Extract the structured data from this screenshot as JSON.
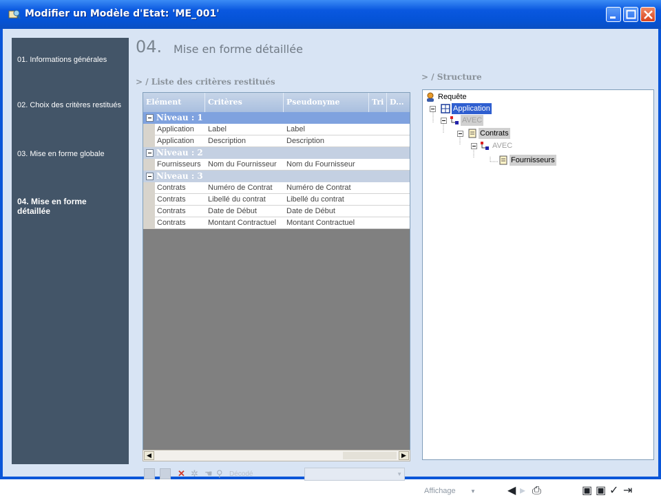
{
  "window": {
    "title": "Modifier un Modèle d'Etat: 'ME_001'"
  },
  "nav": {
    "items": [
      {
        "label": "01. Informations générales"
      },
      {
        "label": "02. Choix des critères restitués"
      },
      {
        "label": "03. Mise en forme globale"
      },
      {
        "label": "04. Mise en forme détaillée"
      }
    ]
  },
  "main": {
    "step_number": "04.",
    "step_title": "Mise en forme détaillée",
    "list_title": "> / Liste des critères restitués",
    "columns": [
      "Elément",
      "Critères",
      "Pseudonyme",
      "Tri",
      "D..."
    ],
    "groups": [
      {
        "label": "Niveau : 1",
        "rows": [
          [
            "Application",
            "Label",
            "Label"
          ],
          [
            "Application",
            "Description",
            "Description"
          ]
        ]
      },
      {
        "label": "Niveau : 2",
        "rows": [
          [
            "Fournisseurs",
            "Nom du Fournisseur",
            "Nom du Fournisseur"
          ]
        ]
      },
      {
        "label": "Niveau : 3",
        "rows": [
          [
            "Contrats",
            "Numéro de Contrat",
            "Numéro de Contrat"
          ],
          [
            "Contrats",
            "Libellé du contrat",
            "Libellé du contrat"
          ],
          [
            "Contrats",
            "Date de Début",
            "Date de Début"
          ],
          [
            "Contrats",
            "Montant Contractuel",
            "Montant Contractuel"
          ]
        ]
      }
    ],
    "toolbar": {
      "decoded_label": "Décodé"
    }
  },
  "structure": {
    "title": "> / Structure",
    "nodes": [
      {
        "label": "Requête"
      },
      {
        "label": "Application"
      },
      {
        "label": "AVEC"
      },
      {
        "label": "Contrats"
      },
      {
        "label": "AVEC"
      },
      {
        "label": "Fournisseurs"
      }
    ]
  },
  "footer": {
    "affichage_label": "Affichage"
  },
  "colors": {
    "accent": "#0a56d8",
    "nav_bg": "#435568",
    "selection": "#2f5fd0"
  }
}
